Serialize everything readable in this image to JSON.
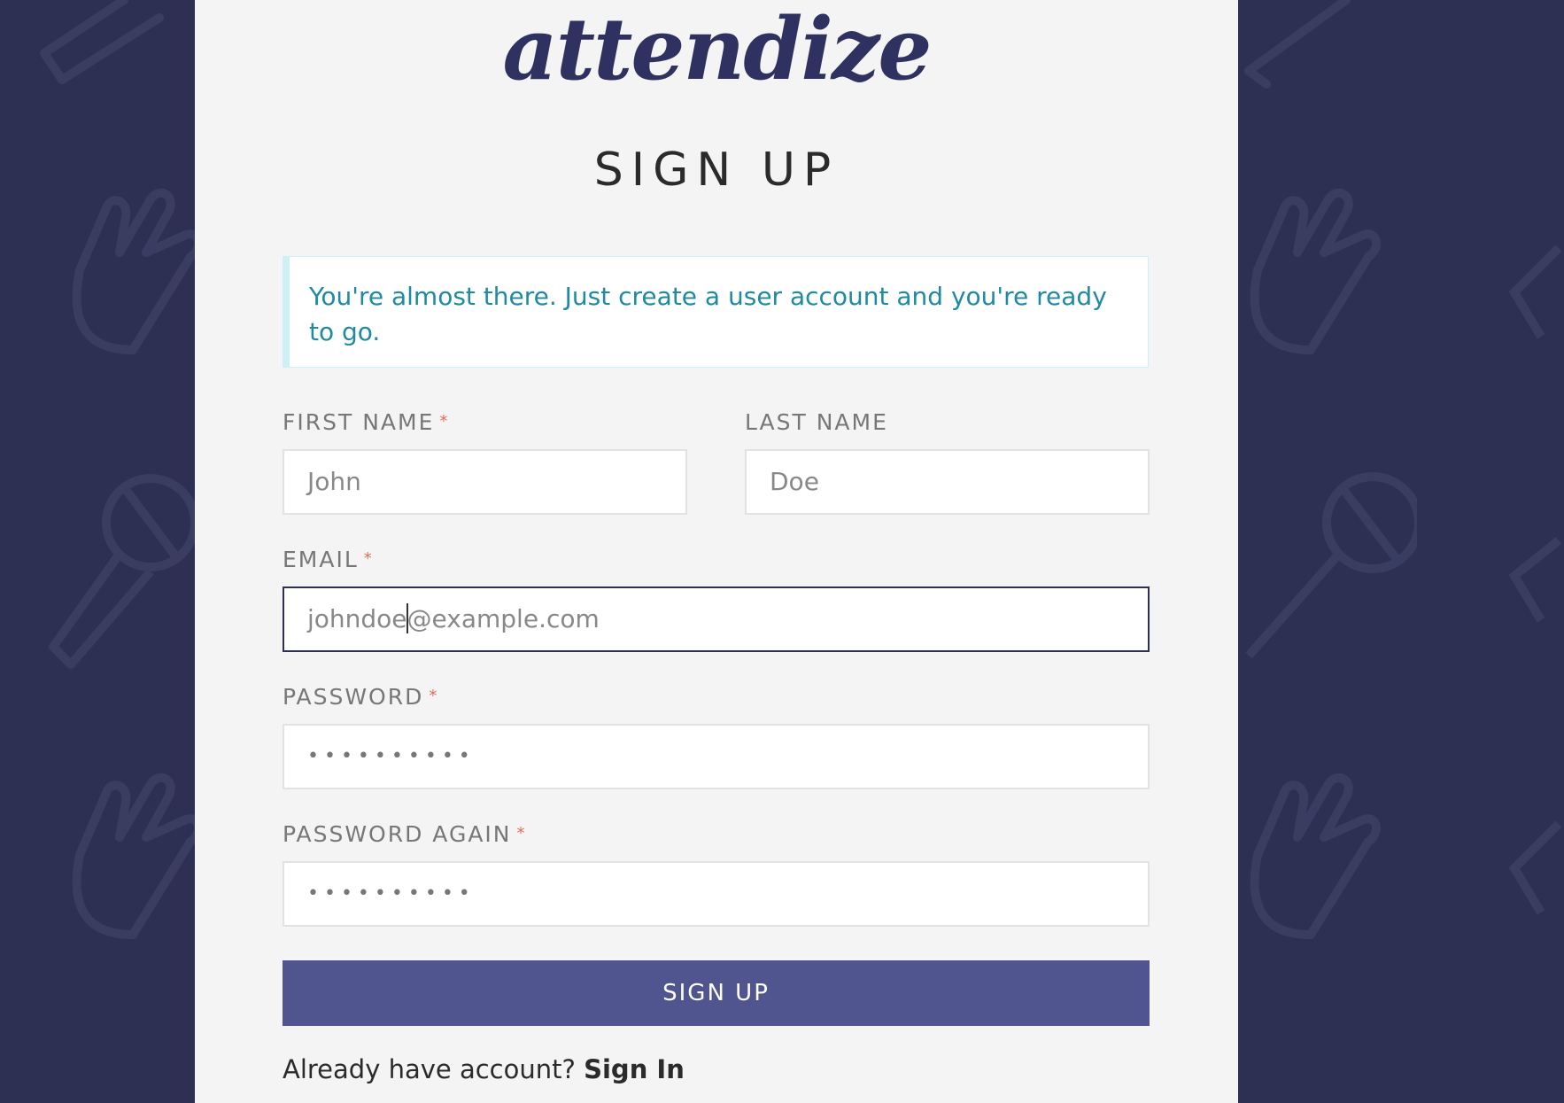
{
  "brand": {
    "logo_text": "attendize"
  },
  "page": {
    "title": "SIGN UP"
  },
  "alert": {
    "message": "You're almost there. Just create a user account and you're ready to go."
  },
  "form": {
    "first_name": {
      "label": "FIRST NAME",
      "placeholder": "John",
      "value": "",
      "required": true
    },
    "last_name": {
      "label": "LAST NAME",
      "placeholder": "Doe",
      "value": ""
    },
    "email": {
      "label": "EMAIL",
      "value_before_caret": "johndoe",
      "value_after_caret": "@example.com",
      "required": true
    },
    "password": {
      "label": "PASSWORD",
      "masked_value": "••••••••••",
      "required": true
    },
    "password_again": {
      "label": "PASSWORD AGAIN",
      "masked_value": "••••••••••",
      "required": true
    },
    "required_marker": "*",
    "submit_label": "SIGN UP"
  },
  "footer": {
    "prompt": "Already have account?",
    "link_label": "Sign In"
  },
  "colors": {
    "background": "#2d3052",
    "panel": "#f4f4f5",
    "brand": "#2f3160",
    "button": "#50548f",
    "alert_text": "#1f8aa0",
    "required": "#e06c5a"
  },
  "icons": [
    "hand-icon",
    "microphone-icon"
  ]
}
